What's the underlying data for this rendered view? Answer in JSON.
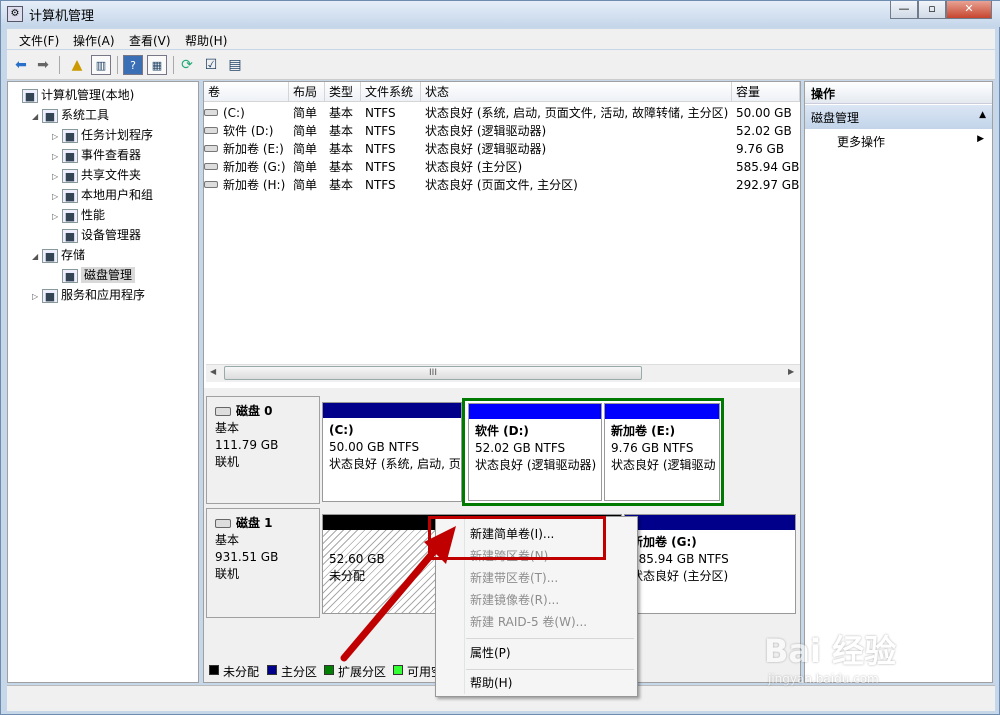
{
  "window": {
    "title": "计算机管理",
    "buttons": [
      "—",
      "▫",
      "✕"
    ]
  },
  "menu": [
    "文件(F)",
    "操作(A)",
    "查看(V)",
    "帮助(H)"
  ],
  "toolbar_icons": [
    "back-icon",
    "forward-icon",
    "up-folder-icon",
    "show-hide-tree-icon",
    "help-icon",
    "action-pane-icon",
    "refresh-icon",
    "properties-icon",
    "rescan-icon"
  ],
  "tree": [
    {
      "label": "计算机管理(本地)",
      "indent": 0,
      "expander": "",
      "icon": "computer-icon"
    },
    {
      "label": "系统工具",
      "indent": 1,
      "expander": "◢",
      "icon": "tools-icon"
    },
    {
      "label": "任务计划程序",
      "indent": 2,
      "expander": "▷",
      "icon": "clock-icon"
    },
    {
      "label": "事件查看器",
      "indent": 2,
      "expander": "▷",
      "icon": "event-viewer-icon"
    },
    {
      "label": "共享文件夹",
      "indent": 2,
      "expander": "▷",
      "icon": "shared-folder-icon"
    },
    {
      "label": "本地用户和组",
      "indent": 2,
      "expander": "▷",
      "icon": "users-icon"
    },
    {
      "label": "性能",
      "indent": 2,
      "expander": "▷",
      "icon": "performance-icon"
    },
    {
      "label": "设备管理器",
      "indent": 2,
      "expander": "",
      "icon": "device-manager-icon"
    },
    {
      "label": "存储",
      "indent": 1,
      "expander": "◢",
      "icon": "storage-icon"
    },
    {
      "label": "磁盘管理",
      "indent": 2,
      "expander": "",
      "icon": "disk-management-icon",
      "selected": true
    },
    {
      "label": "服务和应用程序",
      "indent": 1,
      "expander": "▷",
      "icon": "services-icon"
    }
  ],
  "volume_table": {
    "columns": [
      "卷",
      "布局",
      "类型",
      "文件系统",
      "状态",
      "容量"
    ],
    "rows": [
      [
        "(C:)",
        "简单",
        "基本",
        "NTFS",
        "状态良好 (系统, 启动, 页面文件, 活动, 故障转储, 主分区)",
        "50.00 GB"
      ],
      [
        "软件 (D:)",
        "简单",
        "基本",
        "NTFS",
        "状态良好 (逻辑驱动器)",
        "52.02 GB"
      ],
      [
        "新加卷 (E:)",
        "简单",
        "基本",
        "NTFS",
        "状态良好 (逻辑驱动器)",
        "9.76 GB"
      ],
      [
        "新加卷 (G:)",
        "简单",
        "基本",
        "NTFS",
        "状态良好 (主分区)",
        "585.94 GB"
      ],
      [
        "新加卷 (H:)",
        "简单",
        "基本",
        "NTFS",
        "状态良好 (页面文件, 主分区)",
        "292.97 GB"
      ]
    ],
    "scroll_grip": "III"
  },
  "disks": [
    {
      "name": "磁盘 0",
      "type": "基本",
      "size": "111.79 GB",
      "status": "联机",
      "partitions": [
        {
          "title": "(C:)",
          "line1": "50.00 GB NTFS",
          "line2": "状态良好 (系统, 启动, 页",
          "bar_color": "#00008b"
        },
        {
          "title": "软件  (D:)",
          "line1": "52.02 GB NTFS",
          "line2": "状态良好 (逻辑驱动器)",
          "bar_color": "#0000ff"
        },
        {
          "title": "新加卷  (E:)",
          "line1": "9.76 GB NTFS",
          "line2": "状态良好 (逻辑驱动",
          "bar_color": "#0000ff"
        }
      ]
    },
    {
      "name": "磁盘 1",
      "type": "基本",
      "size": "931.51 GB",
      "status": "联机",
      "partitions": [
        {
          "title": "",
          "line1": "52.60 GB",
          "line2": "未分配",
          "bar_color": "#000000"
        },
        {
          "title": "新加卷  (G:)",
          "line1": "585.94 GB NTFS",
          "line2": "状态良好 (主分区)",
          "bar_color": "#00008b"
        }
      ]
    }
  ],
  "legend": [
    {
      "label": "未分配",
      "color": "#000000"
    },
    {
      "label": "主分区",
      "color": "#00008b"
    },
    {
      "label": "扩展分区",
      "color": "#008000"
    },
    {
      "label": "可用空间",
      "color": "#33ff33"
    }
  ],
  "actions_pane": {
    "header": "操作",
    "section": "磁盘管理",
    "items": [
      "更多操作"
    ]
  },
  "context_menu": {
    "items": [
      {
        "label": "新建简单卷(I)...",
        "enabled": true
      },
      {
        "label": "新建跨区卷(N)...",
        "enabled": false
      },
      {
        "label": "新建带区卷(T)...",
        "enabled": false
      },
      {
        "label": "新建镜像卷(R)...",
        "enabled": false
      },
      {
        "label": "新建 RAID-5 卷(W)...",
        "enabled": false
      },
      {
        "label": "属性(P)",
        "enabled": true
      },
      {
        "label": "帮助(H)",
        "enabled": true
      }
    ]
  },
  "annotation": {
    "color": "#c00000"
  },
  "watermark": {
    "brand": "Bai  经验",
    "url": "jingyan.baidu.com"
  }
}
